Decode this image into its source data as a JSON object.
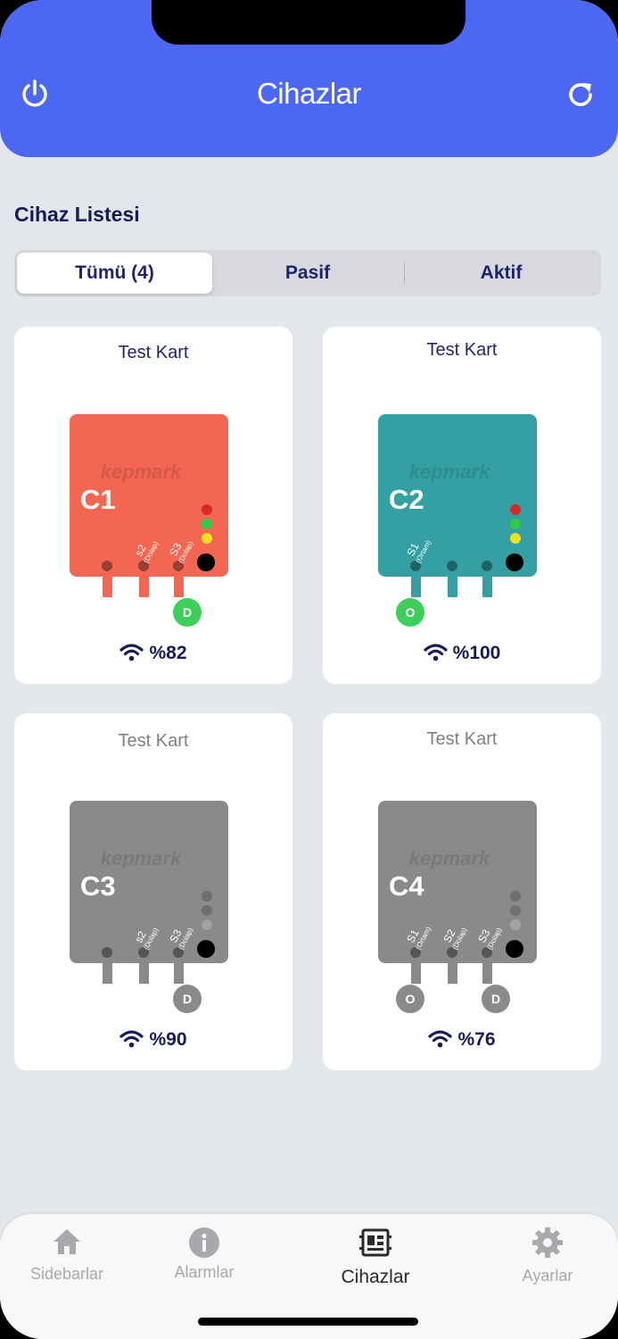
{
  "header": {
    "title": "Cihazlar",
    "left_icon": "power-icon",
    "right_icon": "refresh-icon"
  },
  "section": {
    "title": "Cihaz Listesi"
  },
  "filter_tabs": [
    {
      "label": "Tümü (4)",
      "active": true
    },
    {
      "label": "Pasif",
      "active": false
    },
    {
      "label": "Aktif",
      "active": false
    }
  ],
  "devices": [
    {
      "title": "Test Kart",
      "code": "C1",
      "brand": "kepmark",
      "active": true,
      "color": "#f26652",
      "sensors": [
        "",
        "s2 (Dolap)",
        "S3 (Dolap)"
      ],
      "badges": [
        "",
        "",
        "D"
      ],
      "leds": [
        "#d62828",
        "#2ecc40",
        "#f5e11b"
      ],
      "signal": "%82"
    },
    {
      "title": "Test Kart",
      "code": "C2",
      "brand": "kepmark",
      "active": true,
      "color": "#34a0a4",
      "sensors": [
        "S1 (Ortam)",
        "",
        ""
      ],
      "badges": [
        "O",
        "",
        ""
      ],
      "leds": [
        "#d62828",
        "#2ecc40",
        "#f5e11b"
      ],
      "signal": "%100"
    },
    {
      "title": "Test Kart",
      "code": "C3",
      "brand": "kepmark",
      "active": false,
      "color": "#8a8a8a",
      "sensors": [
        "",
        "s2 (Dolap)",
        "S3 (Dolap)"
      ],
      "badges": [
        "",
        "",
        "D"
      ],
      "leds": [
        "#6f6f6f",
        "#6f6f6f",
        "#a3a3a3"
      ],
      "signal": "%90"
    },
    {
      "title": "Test Kart",
      "code": "C4",
      "brand": "kepmark",
      "active": false,
      "color": "#8a8a8a",
      "sensors": [
        "S1 (Ortam)",
        "S2 (Dolap)",
        "S3 (Dolap)"
      ],
      "badges": [
        "O",
        "",
        "D"
      ],
      "leds": [
        "#6f6f6f",
        "#6f6f6f",
        "#a3a3a3"
      ],
      "signal": "%76"
    }
  ],
  "tabbar": [
    {
      "label": "Sidebarlar",
      "icon": "home-icon",
      "active": false
    },
    {
      "label": "Alarmlar",
      "icon": "info-icon",
      "active": false
    },
    {
      "label": "Cihazlar",
      "icon": "devices-icon",
      "active": true
    },
    {
      "label": "Ayarlar",
      "icon": "gear-icon",
      "active": false
    }
  ],
  "colors": {
    "accent": "#4c67f2",
    "badge_active": "#3ecf5b",
    "badge_inactive": "#8a8a8a"
  }
}
